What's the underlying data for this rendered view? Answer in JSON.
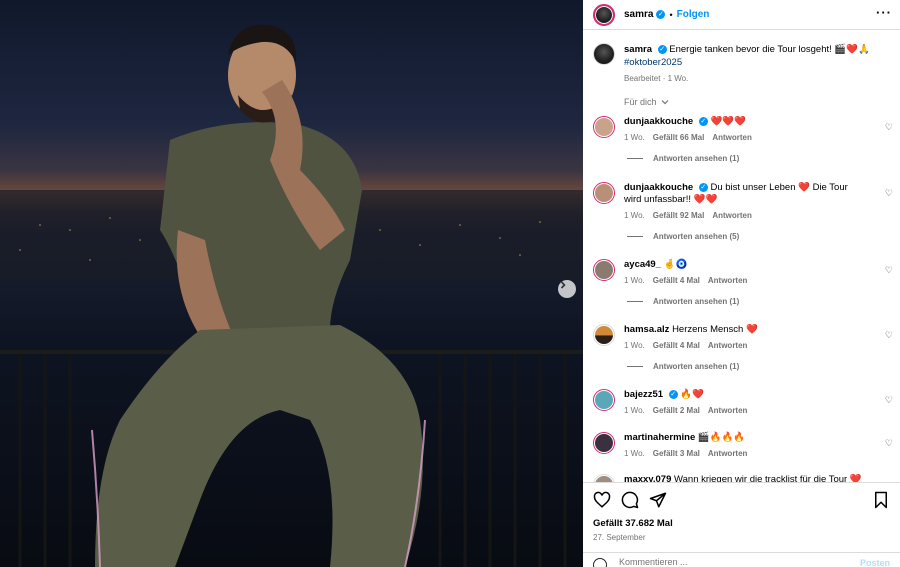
{
  "post": {
    "username": "samra",
    "follow_label": "Folgen",
    "more_icon": "more-horizontal-icon",
    "caption_text": "Energie tanken bevor die Tour losgeht! 🎬❤️🙏",
    "caption_hashtag": "#oktober2025",
    "caption_meta": "Bearbeitet · 1 Wo.",
    "sort_label": "Für dich"
  },
  "comments": [
    {
      "user": "dunjaakkouche",
      "verified": true,
      "text": "❤️❤️❤️",
      "time": "1 Wo.",
      "likes": "Gefällt 66 Mal",
      "reply": "Antworten",
      "view_replies": "Antworten ansehen (1)",
      "avatar_color": "#c9a28a"
    },
    {
      "user": "dunjaakkouche",
      "verified": true,
      "text": "Du bist unser Leben ❤️ Die Tour wird unfassbar!! ❤️❤️",
      "time": "1 Wo.",
      "likes": "Gefällt 92 Mal",
      "reply": "Antworten",
      "view_replies": "Antworten ansehen (5)",
      "avatar_color": "#b89077"
    },
    {
      "user": "ayca49_",
      "verified": false,
      "text": "🤞🧿",
      "time": "1 Wo.",
      "likes": "Gefällt 4 Mal",
      "reply": "Antworten",
      "view_replies": "Antworten ansehen (1)",
      "avatar_color": "#8a7a70"
    },
    {
      "user": "hamsa.alz",
      "verified": false,
      "text": "Herzens Mensch ❤️",
      "time": "1 Wo.",
      "likes": "Gefällt 4 Mal",
      "reply": "Antworten",
      "view_replies": "Antworten ansehen (1)",
      "avatar_color": "#d08a3a"
    },
    {
      "user": "bajezz51",
      "verified": true,
      "text": "🔥❤️",
      "time": "1 Wo.",
      "likes": "Gefällt 2 Mal",
      "reply": "Antworten",
      "view_replies": "",
      "avatar_color": "#5aa7b8"
    },
    {
      "user": "martinahermine",
      "verified": false,
      "text": "🎬🔥🔥🔥",
      "time": "1 Wo.",
      "likes": "Gefällt 3 Mal",
      "reply": "Antworten",
      "view_replies": "",
      "avatar_color": "#3a3040"
    },
    {
      "user": "maxxy.079",
      "verified": false,
      "text": "Wann kriegen wir die tracklist für die Tour ❤️",
      "time": "",
      "likes": "",
      "reply": "",
      "view_replies": "",
      "avatar_color": "#a08c80"
    }
  ],
  "actions": {
    "likes_text": "Gefällt 37.682 Mal",
    "date_text": "27. September",
    "comment_placeholder": "Kommentieren ...",
    "post_label": "Posten"
  },
  "colors": {
    "accent": "#0095f6",
    "heart": "#e0142b",
    "muted": "#737373"
  }
}
